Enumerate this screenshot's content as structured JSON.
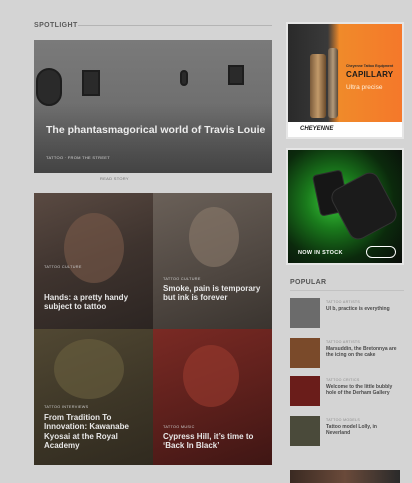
{
  "spotlight": {
    "heading": "SPOTLIGHT",
    "hero": {
      "category": "TATTOO · FROM THE STREET",
      "title": "The phantasmagorical world of Travis Louie",
      "read_label": "READ STORY"
    }
  },
  "grid": [
    {
      "category": "TATTOO CULTURE",
      "title": "Hands: a pretty handy subject to tattoo"
    },
    {
      "category": "TATTOO CULTURE",
      "title": "Smoke, pain is temporary but ink is forever"
    },
    {
      "category": "TATTOO INTERVIEWS",
      "title": "From Tradition To Innovation: Kawanabe Kyosai at the Royal Academy"
    },
    {
      "category": "TATTOO MUSIC",
      "title": "Cypress Hill, it’s time to ‘Back In Black’"
    }
  ],
  "ads": {
    "capillary": {
      "small": "Cheyenne Tattoo Equipment",
      "brand": "CAPILLARY",
      "tagline": "Ultra precise",
      "company": "CHEYENNE"
    },
    "stock": {
      "text": "NOW IN STOCK"
    }
  },
  "popular": {
    "heading": "POPULAR",
    "items": [
      {
        "category": "TATTOO ARTISTS",
        "title": "Ul b, practice is everything",
        "thumb_color": "#6b6b6b"
      },
      {
        "category": "TATTOO ARTISTS",
        "title": "Marsuddin, the Bretonnya are the icing on the cake",
        "thumb_color": "#7a4a2a"
      },
      {
        "category": "TATTOO CRITICS",
        "title": "Welcome to the little bubbly hole of the Derham Gallery",
        "thumb_color": "#6a1d1a"
      },
      {
        "category": "TATTOO MODELS",
        "title": "Tattoo model Lolly, in Neverland",
        "thumb_color": "#4a4a3a"
      }
    ]
  }
}
